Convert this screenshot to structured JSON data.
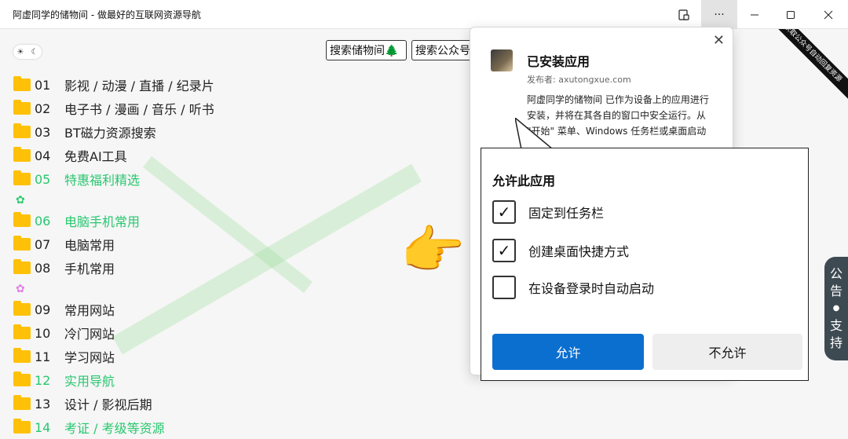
{
  "window": {
    "title": "阿虚同学的储物间 - 做最好的互联网资源导航",
    "more_icon": "···"
  },
  "page": {
    "theme_icons": [
      "☀",
      "☾"
    ],
    "search_buttons": [
      "搜索储物间🌲",
      "搜索公众号"
    ],
    "ribbon_text": "获取公众号自动回复资源",
    "side_badge": [
      "公",
      "告",
      "●",
      "支",
      "持"
    ],
    "list": [
      {
        "num": "01",
        "label": "影视 / 动漫 / 直播 / 纪录片",
        "highlight": false
      },
      {
        "num": "02",
        "label": "电子书 / 漫画 / 音乐 / 听书",
        "highlight": false
      },
      {
        "num": "03",
        "label": "BT磁力资源搜索",
        "highlight": false
      },
      {
        "num": "04",
        "label": "免费AI工具",
        "highlight": false
      },
      {
        "num": "05",
        "label": "特惠福利精选",
        "highlight": true
      },
      {
        "num": "06",
        "label": "电脑手机常用",
        "highlight": true
      },
      {
        "num": "07",
        "label": "电脑常用",
        "highlight": false
      },
      {
        "num": "08",
        "label": "手机常用",
        "highlight": false
      },
      {
        "num": "09",
        "label": "常用网站",
        "highlight": false
      },
      {
        "num": "10",
        "label": "冷门网站",
        "highlight": false
      },
      {
        "num": "11",
        "label": "学习网站",
        "highlight": false
      },
      {
        "num": "12",
        "label": "实用导航",
        "highlight": true
      },
      {
        "num": "13",
        "label": "设计 / 影视后期",
        "highlight": false
      },
      {
        "num": "14",
        "label": "考证 / 考级等资源",
        "highlight": true
      }
    ],
    "gear_colors": [
      "#2ecc71",
      "#e37de8"
    ]
  },
  "installed_dialog": {
    "title": "已安装应用",
    "publisher": "发布者: axutongxue.com",
    "body": "阿虚同学的储物间 已作为设备上的应用进行安装，并将在其各自的窗口中安全运行。从 \"开始\" 菜单、Windows 任务栏或桌面启动它。",
    "close_icon": "✕"
  },
  "permission_panel": {
    "title": "允许此应用",
    "options": [
      {
        "label": "固定到任务栏",
        "checked": true
      },
      {
        "label": "创建桌面快捷方式",
        "checked": true
      },
      {
        "label": "在设备登录时自动启动",
        "checked": false
      }
    ],
    "allow_label": "允许",
    "deny_label": "不允许"
  },
  "pointer": "👉"
}
